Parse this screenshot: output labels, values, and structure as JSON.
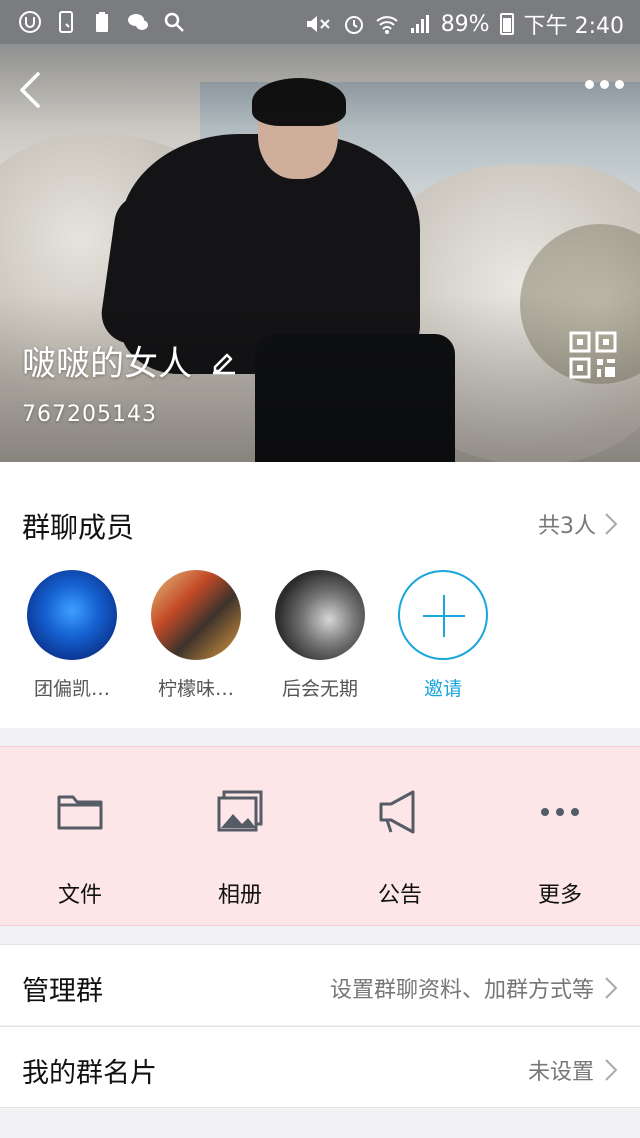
{
  "status_bar": {
    "battery": "89%",
    "time": "下午 2:40",
    "icons": [
      "app-u-icon",
      "phone-icon",
      "recycle-battery-icon",
      "wechat-icon",
      "search-icon",
      "mute-icon",
      "alarm-icon",
      "wifi-icon",
      "signal-icon",
      "battery-icon"
    ]
  },
  "hero": {
    "group_name": "啵啵的女人",
    "group_id": "767205143"
  },
  "members": {
    "title": "群聊成员",
    "count": "共3人",
    "list": [
      {
        "name": "团偏凯…"
      },
      {
        "name": "柠檬味…"
      },
      {
        "name": "后会无期"
      }
    ],
    "invite_label": "邀请"
  },
  "actions": [
    {
      "label": "文件",
      "icon": "folder-icon"
    },
    {
      "label": "相册",
      "icon": "album-icon"
    },
    {
      "label": "公告",
      "icon": "megaphone-icon"
    },
    {
      "label": "更多",
      "icon": "more-icon"
    }
  ],
  "rows": {
    "manage": {
      "title": "管理群",
      "value": "设置群聊资料、加群方式等"
    },
    "card": {
      "title": "我的群名片",
      "value": "未设置"
    }
  },
  "colors": {
    "accent": "#19a6dc",
    "action_panel_bg": "#fde6e8"
  }
}
